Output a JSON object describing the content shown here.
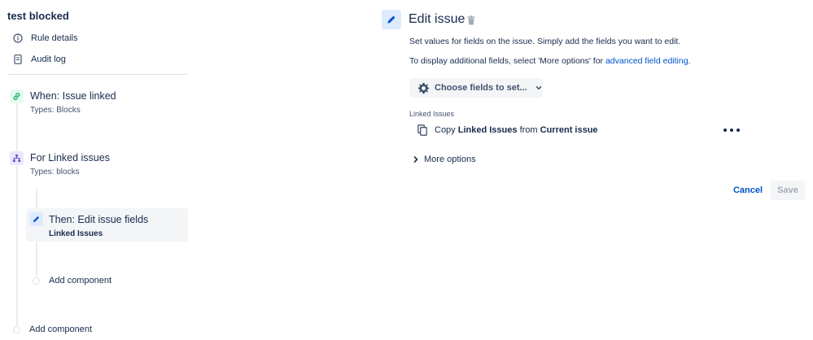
{
  "rule": {
    "title": "test blocked",
    "nav": [
      {
        "label": "Rule details",
        "icon": "info-icon"
      },
      {
        "label": "Audit log",
        "icon": "document-icon"
      }
    ],
    "components": {
      "trigger": {
        "title": "When: Issue linked",
        "subtitle": "Types: Blocks",
        "icon": "link-icon",
        "color": "#36b37e"
      },
      "branch": {
        "title": "For Linked issues",
        "subtitle": "Types: blocks",
        "icon": "branch-icon",
        "color": "#6554c0"
      },
      "action": {
        "title": "Then: Edit issue fields",
        "subtitle": "Linked Issues",
        "icon": "pencil-icon",
        "color": "#0052cc"
      }
    },
    "add_component_nested": "Add component",
    "add_component_main": "Add component"
  },
  "editor": {
    "title": "Edit issue",
    "description": "Set values for fields on the issue. Simply add the fields you want to edit.",
    "additional_prefix": "To display additional fields, select 'More options' for ",
    "additional_link": "advanced field editing",
    "additional_suffix": ".",
    "choose_fields_label": "Choose fields to set...",
    "field_label": "Linked Issues",
    "field_row": {
      "prefix": "Copy",
      "field": "Linked Issues",
      "middle": "from",
      "source": "Current issue"
    },
    "more_options_label": "More options",
    "cancel_label": "Cancel",
    "save_label": "Save"
  },
  "colors": {
    "accent": "#0052cc",
    "text": "#172b4d",
    "subtle_text": "#42526e",
    "trigger_bg": "#e3fcef",
    "branch_bg": "#eae6ff",
    "action_bg": "#deebff",
    "disabled_text": "#a5adba"
  }
}
